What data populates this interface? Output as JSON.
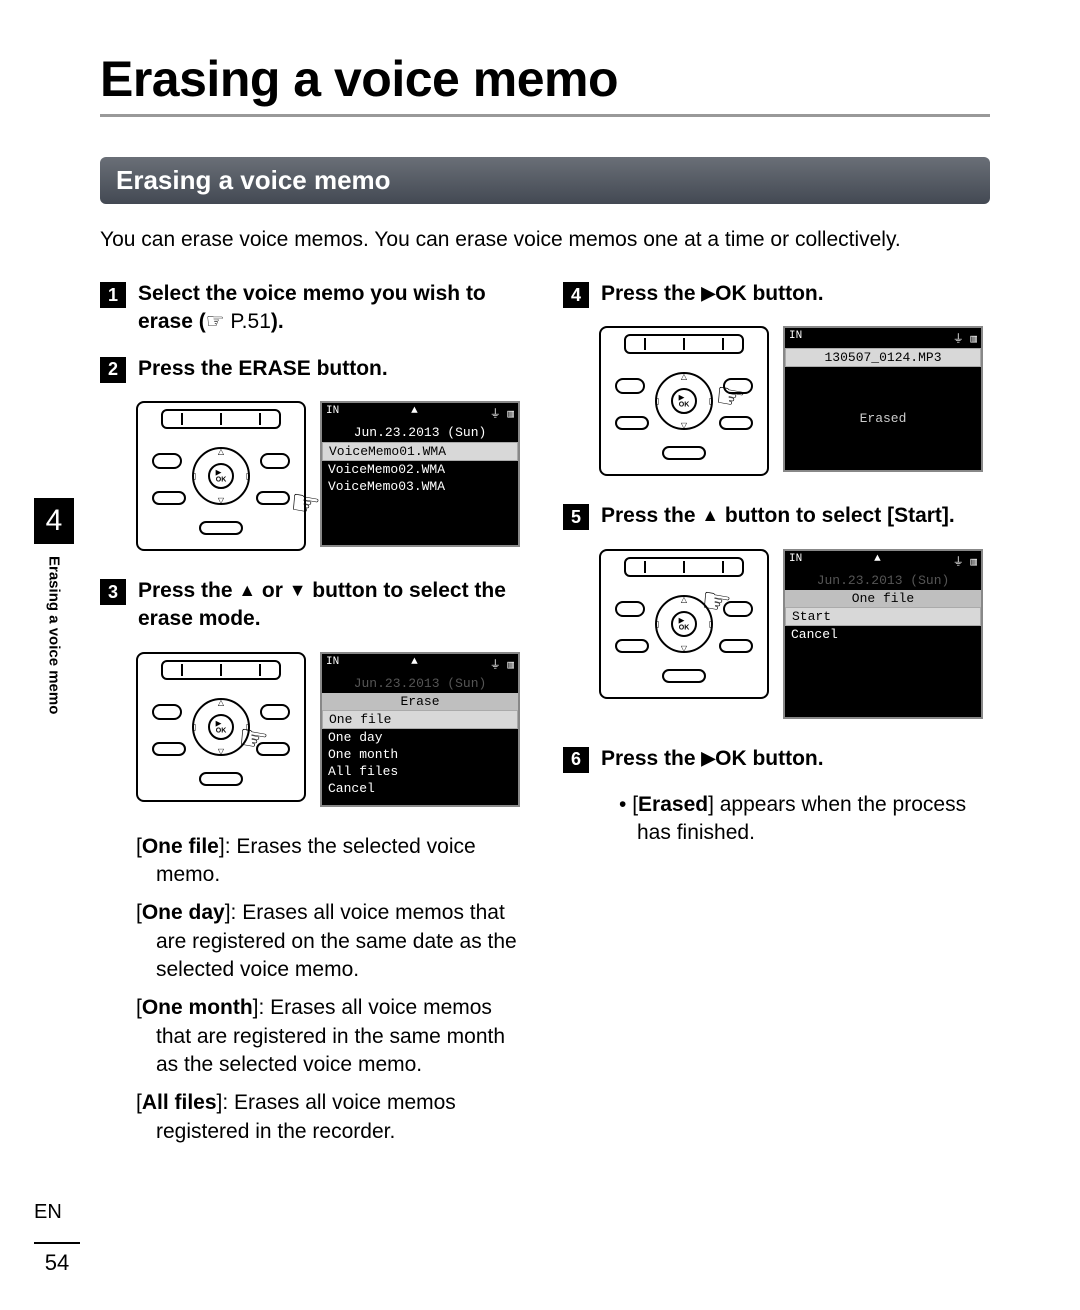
{
  "title": "Erasing a voice memo",
  "section_header": "Erasing a voice memo",
  "intro": "You can erase voice memos. You can erase voice memos one at a time or collectively.",
  "sidetab": {
    "chapter": "4",
    "label": "Erasing a voice memo"
  },
  "footer": {
    "lang": "EN",
    "page": "54"
  },
  "glyphs": {
    "up": "▲",
    "down": "▼",
    "play": "▶",
    "ref": "☞"
  },
  "steps": {
    "s1": {
      "num": "1",
      "pre": "Select the voice memo you wish to erase (",
      "ref_page": " P.51",
      "post": ")."
    },
    "s2": {
      "num": "2",
      "pre": "Press the ",
      "btn": "ERASE",
      "post": " button."
    },
    "s3": {
      "num": "3",
      "pre": "Press the ",
      "mid": " or ",
      "post": " button to select the erase mode."
    },
    "s4": {
      "num": "4",
      "pre": "Press the ",
      "btn": "OK",
      "post": " button."
    },
    "s5": {
      "num": "5",
      "pre": "Press the ",
      "post1": " button to select [",
      "opt": "Start",
      "post2": "]."
    },
    "s6": {
      "num": "6",
      "pre": "Press the ",
      "btn": "OK",
      "post": " button."
    }
  },
  "step6_note": {
    "pre": "[",
    "b": "Erased",
    "post": "] appears when the process has finished."
  },
  "lcd2": {
    "status_left": "IN",
    "status_mid": "▲",
    "status_right": "⏚ ▥",
    "date": "Jun.23.2013 (Sun)",
    "items": [
      "VoiceMemo01.WMA",
      "VoiceMemo02.WMA",
      "VoiceMemo03.WMA"
    ]
  },
  "lcd3": {
    "status_left": "IN",
    "status_mid": "▲",
    "status_right": "⏚ ▥",
    "date": "Jun.23.2013 (Sun)",
    "banner": "Erase",
    "items": [
      "One file",
      "One day",
      "One month",
      "All files",
      "Cancel"
    ]
  },
  "lcd4": {
    "status_left": "IN",
    "status_mid": "",
    "status_right": "⏚ ▥",
    "filename": "130507_0124.MP3",
    "message": "Erased"
  },
  "lcd5": {
    "status_left": "IN",
    "status_mid": "▲",
    "status_right": "⏚ ▥",
    "date": "Jun.23.2013 (Sun)",
    "banner": "One file",
    "items": [
      "Start",
      "Cancel"
    ]
  },
  "desc": {
    "d1": {
      "label": "One file",
      "text": "]: Erases the selected voice memo."
    },
    "d2": {
      "label": "One day",
      "text": "]: Erases all voice memos that are registered on the same date as the selected voice memo."
    },
    "d3": {
      "label": "One month",
      "text": "]: Erases all voice memos that are registered in the same month as the selected voice memo."
    },
    "d4": {
      "label": "All files",
      "text": "]: Erases all voice memos registered in the recorder."
    }
  }
}
